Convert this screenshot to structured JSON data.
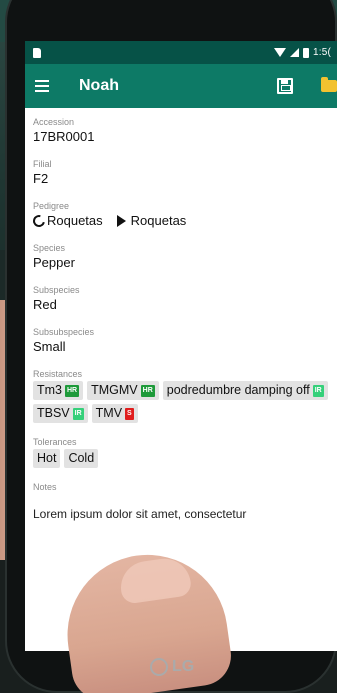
{
  "status_bar": {
    "time": "1:5("
  },
  "app_bar": {
    "title": "Noah"
  },
  "fields": {
    "accession": {
      "label": "Accession",
      "value": "17BR0001"
    },
    "filial": {
      "label": "Filial",
      "value": "F2"
    },
    "pedigree": {
      "label": "Pedigree",
      "female": "Roquetas",
      "male": "Roquetas"
    },
    "species": {
      "label": "Species",
      "value": "Pepper"
    },
    "subspecies": {
      "label": "Subspecies",
      "value": "Red"
    },
    "subsubspecies": {
      "label": "Subsubspecies",
      "value": "Small"
    },
    "resistances": {
      "label": "Resistances",
      "items": [
        {
          "name": "Tm3",
          "level": "HR"
        },
        {
          "name": "TMGMV",
          "level": "HR"
        },
        {
          "name": "podredumbre damping off",
          "level": "IR"
        },
        {
          "name": "TBSV",
          "level": "IR"
        },
        {
          "name": "TMV",
          "level": "S"
        }
      ]
    },
    "tolerances": {
      "label": "Tolerances",
      "items": [
        "Hot",
        "Cold"
      ]
    },
    "notes": {
      "label": "Notes",
      "value": "Lorem ipsum dolor sit amet, consectetur"
    }
  },
  "colors": {
    "app_bar": "#0d7a66",
    "status_bar": "#065247",
    "badge_hr": "#1e9a3a",
    "badge_ir": "#35d07a",
    "badge_s": "#e01d1d",
    "folder": "#f2c230"
  },
  "device": {
    "brand": "LG"
  }
}
